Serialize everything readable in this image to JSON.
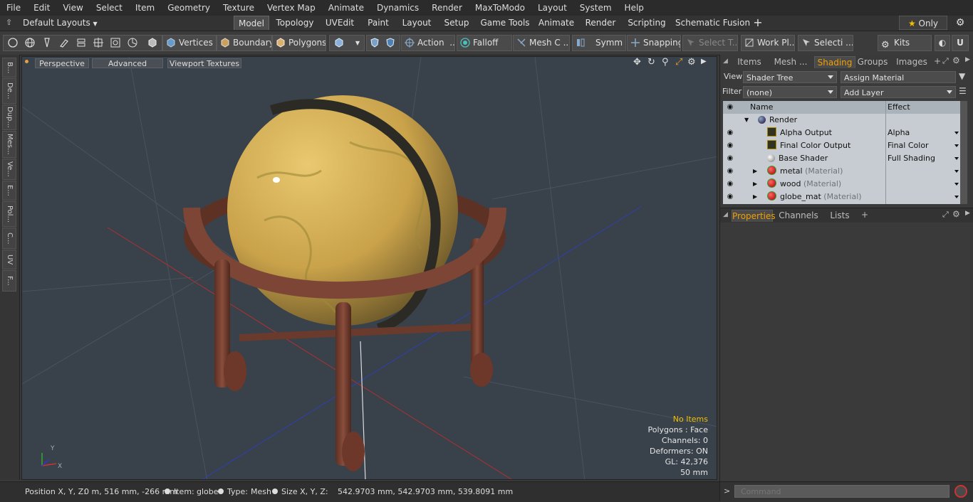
{
  "menu": [
    "File",
    "Edit",
    "View",
    "Select",
    "Item",
    "Geometry",
    "Texture",
    "Vertex Map",
    "Animate",
    "Dynamics",
    "Render",
    "MaxToModo",
    "Layout",
    "System",
    "Help"
  ],
  "layout_selector": "Default Layouts",
  "tabs": [
    "Model",
    "Topology",
    "UVEdit",
    "Paint",
    "Layout",
    "Setup",
    "Game Tools",
    "Animate",
    "Render",
    "Scripting",
    "Schematic Fusion"
  ],
  "active_tab": "Model",
  "only_label": "Only",
  "toolbar": {
    "vertices": "Vertices",
    "boundary": "Boundary",
    "polygons": "Polygons",
    "action": "Action",
    "falloff": "Falloff",
    "mesh_c": "Mesh C ...",
    "symm": "Symm ...",
    "snapping": "Snapping",
    "select_t": "Select T...",
    "work_pl": "Work Pl...",
    "selecti": "Selecti ...",
    "kits": "Kits"
  },
  "left_tabs": [
    "B...",
    "De...",
    "Dup...",
    "Mes...",
    "Ve...",
    "E...",
    "Pol...",
    "C...",
    "UV",
    "F..."
  ],
  "viewport": {
    "perspective": "Perspective",
    "advanced": "Advanced",
    "viewport_textures": "Viewport Textures",
    "info": {
      "no_items": "No Items",
      "polygons": "Polygons : Face",
      "channels": "Channels: 0",
      "deformers": "Deformers: ON",
      "gl": "GL: 42,376",
      "unit": "50 mm"
    }
  },
  "status": {
    "position_label": "Position X, Y, Z:",
    "position_value": "0 m, 516 mm, -266 mm",
    "item_label": "Item:",
    "item_value": "globe",
    "type_label": "Type:",
    "type_value": "Mesh",
    "size_label": "Size X, Y, Z:",
    "size_value": "542.9703 mm, 542.9703 mm, 539.8091 mm"
  },
  "right_panel": {
    "tabs": [
      "Items",
      "Mesh ...",
      "Shading",
      "Groups",
      "Images"
    ],
    "active_tab": "Shading",
    "view_label": "View",
    "view_value": "Shader Tree",
    "assign_material": "Assign Material",
    "filter_label": "Filter",
    "filter_value": "(none)",
    "add_layer": "Add Layer",
    "columns": {
      "name": "Name",
      "effect": "Effect"
    },
    "rows": [
      {
        "name": "Render",
        "suffix": "",
        "effect": "",
        "icon": "render-sphere-icon"
      },
      {
        "name": "Alpha Output",
        "suffix": "",
        "effect": "Alpha",
        "icon": "output-icon"
      },
      {
        "name": "Final Color Output",
        "suffix": "",
        "effect": "Final Color",
        "icon": "output-icon"
      },
      {
        "name": "Base Shader",
        "suffix": "",
        "effect": "Full Shading",
        "icon": "shader-sphere-icon"
      },
      {
        "name": "metal",
        "suffix": "(Material)",
        "effect": "",
        "icon": "material-icon"
      },
      {
        "name": "wood",
        "suffix": "(Material)",
        "effect": "",
        "icon": "material-icon"
      },
      {
        "name": "globe_mat",
        "suffix": "(Material)",
        "effect": "",
        "icon": "material-icon"
      }
    ],
    "bottom_tabs": [
      "Properties",
      "Channels",
      "Lists"
    ],
    "bottom_active": "Properties",
    "command_placeholder": "Command"
  },
  "colors": {
    "accent": "#f0a000",
    "viewport_bg": "#39414a",
    "shader_bg": "#c6ccd1"
  }
}
